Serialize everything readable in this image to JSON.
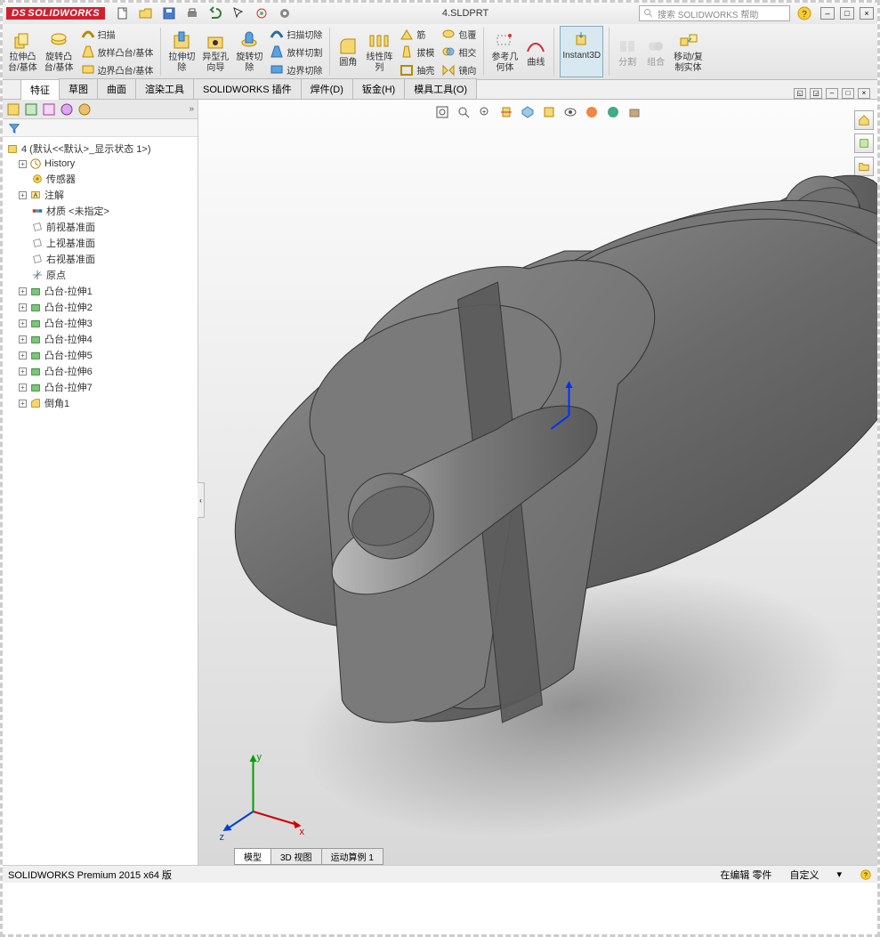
{
  "app": {
    "name": "SOLIDWORKS",
    "title": "4.SLDPRT"
  },
  "search": {
    "placeholder": "搜索 SOLIDWORKS 帮助"
  },
  "ribbon": {
    "extrude": "拉伸凸\n台/基体",
    "revolve": "旋转凸\n台/基体",
    "sweep": "扫描",
    "loft": "放样凸台/基体",
    "boundary": "边界凸台/基体",
    "cut_extrude": "拉伸切\n除",
    "hole": "异型孔\n向导",
    "cut_revolve": "旋转切\n除",
    "cut_sweep": "扫描切除",
    "cut_loft": "放样切割",
    "cut_boundary": "边界切除",
    "fillet": "圆角",
    "pattern": "线性阵\n列",
    "rib": "筋",
    "draft": "拔模",
    "shell": "抽壳",
    "wrap": "包覆",
    "intersect": "相交",
    "mirror": "镜向",
    "refgeom": "参考几\n何体",
    "curves": "曲线",
    "instant3d": "Instant3D",
    "split": "分割",
    "combine": "组合",
    "move": "移动/复\n制实体"
  },
  "tabs": [
    "特征",
    "草图",
    "曲面",
    "渲染工具",
    "SOLIDWORKS 插件",
    "焊件(D)",
    "钣金(H)",
    "模具工具(O)"
  ],
  "tree": {
    "root": "4 (默认<<默认>_显示状态 1>)",
    "items": [
      {
        "label": "History",
        "icon": "history",
        "expandable": true
      },
      {
        "label": "传感器",
        "icon": "sensor"
      },
      {
        "label": "注解",
        "icon": "annotation",
        "expandable": true
      },
      {
        "label": "材质 <未指定>",
        "icon": "material"
      },
      {
        "label": "前视基准面",
        "icon": "plane"
      },
      {
        "label": "上视基准面",
        "icon": "plane"
      },
      {
        "label": "右视基准面",
        "icon": "plane"
      },
      {
        "label": "原点",
        "icon": "origin"
      },
      {
        "label": "凸台-拉伸1",
        "icon": "feature",
        "expandable": true
      },
      {
        "label": "凸台-拉伸2",
        "icon": "feature",
        "expandable": true
      },
      {
        "label": "凸台-拉伸3",
        "icon": "feature",
        "expandable": true
      },
      {
        "label": "凸台-拉伸4",
        "icon": "feature",
        "expandable": true
      },
      {
        "label": "凸台-拉伸5",
        "icon": "feature",
        "expandable": true
      },
      {
        "label": "凸台-拉伸6",
        "icon": "feature",
        "expandable": true
      },
      {
        "label": "凸台-拉伸7",
        "icon": "feature",
        "expandable": true
      },
      {
        "label": "倒角1",
        "icon": "chamfer",
        "expandable": true
      }
    ]
  },
  "bottom_tabs": [
    "模型",
    "3D 视图",
    "运动算例 1"
  ],
  "status": {
    "version": "SOLIDWORKS Premium 2015 x64 版",
    "editing": "在编辑 零件",
    "custom": "自定义"
  },
  "triad": {
    "x": "x",
    "y": "y",
    "z": "z"
  }
}
